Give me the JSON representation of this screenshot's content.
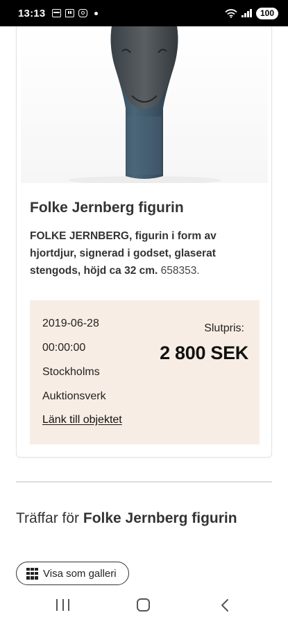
{
  "status_bar": {
    "time": "13:13",
    "battery": "100"
  },
  "item": {
    "title": "Folke Jernberg figurin",
    "description_bold": "FOLKE JERNBERG, figurin i form av hjortdjur, signerad i godset, glaserat stengods, höjd ca 32 cm.",
    "description_id": "658353."
  },
  "sale": {
    "date": "2019-06-28",
    "time": "00:00:00",
    "house_line1": "Stockholms",
    "house_line2": "Auktionsverk",
    "link_label": "Länk till objektet",
    "price_label": "Slutpris:",
    "price": "2 800 SEK"
  },
  "results": {
    "prefix": "Träffar för",
    "query": "Folke Jernberg figurin"
  },
  "gallery_button": {
    "label": "Visa som galleri",
    "icon": "grid-icon"
  },
  "nav": {
    "recent_icon": "recent-apps-icon",
    "home_icon": "home-icon",
    "back_icon": "back-icon"
  },
  "colors": {
    "price_box_bg": "#f8ede4",
    "figurine_blue": "#3e5566"
  }
}
